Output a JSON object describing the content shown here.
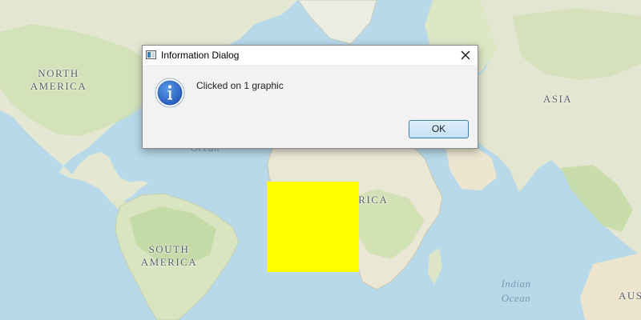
{
  "map": {
    "labels": {
      "north_america": "North\nAmerica",
      "south_america": "South\nAmerica",
      "asia": "Asia",
      "africa": "Africa",
      "australia_partial": "Aus",
      "atlantic_ocean_partial": "Ocean",
      "indian_ocean": "Indian\nOcean"
    },
    "graphic": {
      "color": "#ffff00"
    }
  },
  "dialog": {
    "title": "Information Dialog",
    "message": "Clicked on 1 graphic",
    "ok_label": "OK",
    "icons": {
      "window": "window-icon",
      "close": "close-icon",
      "info": "info-icon"
    }
  },
  "colors": {
    "ocean": "#b7d9ea",
    "land": "#e6e9d6",
    "vegetation": "#c8dcad",
    "ok_border": "#3c7fb1",
    "info_blue": "#2f6fc7"
  }
}
